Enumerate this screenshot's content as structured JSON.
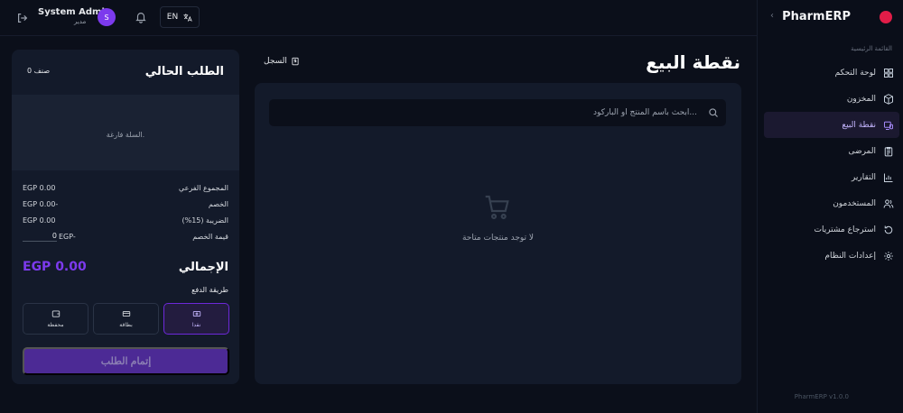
{
  "header": {
    "user_name": "System Admin",
    "user_role": "مدير",
    "avatar_initial": "S",
    "language": "EN"
  },
  "sidebar": {
    "brand": "PharmERP",
    "section_label": "القائمة الرئيسية",
    "items": [
      {
        "label": "لوحة التحكم",
        "icon": "dashboard-icon"
      },
      {
        "label": "المخزون",
        "icon": "box-icon"
      },
      {
        "label": "نقطة البيع",
        "icon": "pos-icon"
      },
      {
        "label": "المرضى",
        "icon": "clipboard-icon"
      },
      {
        "label": "التقارير",
        "icon": "chart-icon"
      },
      {
        "label": "المستخدمون",
        "icon": "users-icon"
      },
      {
        "label": "استرجاع مشتريات",
        "icon": "return-icon"
      },
      {
        "label": "إعدادات النظام",
        "icon": "gear-icon"
      }
    ],
    "active_index": 2,
    "version": "PharmERP v1.0.0"
  },
  "page": {
    "title": "نقطة البيع",
    "history_label": "السجل"
  },
  "products": {
    "search_placeholder": "ابحث باسم المنتج أو الباركود...",
    "empty_text": "لا توجد منتجات متاحة"
  },
  "order": {
    "title": "الطلب الحالي",
    "item_count": "0 صنف",
    "cart_empty": "السلة فارغة.",
    "subtotal_label": "المجموع الفرعي",
    "subtotal_value": "EGP 0.00",
    "discount_label": "الخصم",
    "discount_value": "EGP 0.00-",
    "tax_label": "الضريبة (15%)",
    "tax_value": "EGP 0.00",
    "discount_amount_label": "قيمة الخصم",
    "discount_currency": "EGP-",
    "discount_input_value": "0",
    "total_label": "الإجمالي",
    "total_value": "EGP 0.00",
    "payment_label": "طريقة الدفع",
    "payment_methods": [
      {
        "label": "نقدا",
        "icon": "cash-icon"
      },
      {
        "label": "بطاقة",
        "icon": "card-icon"
      },
      {
        "label": "محفظة",
        "icon": "wallet-icon"
      }
    ],
    "selected_payment": "نقدا",
    "complete_label": "إتمام الطلب"
  }
}
